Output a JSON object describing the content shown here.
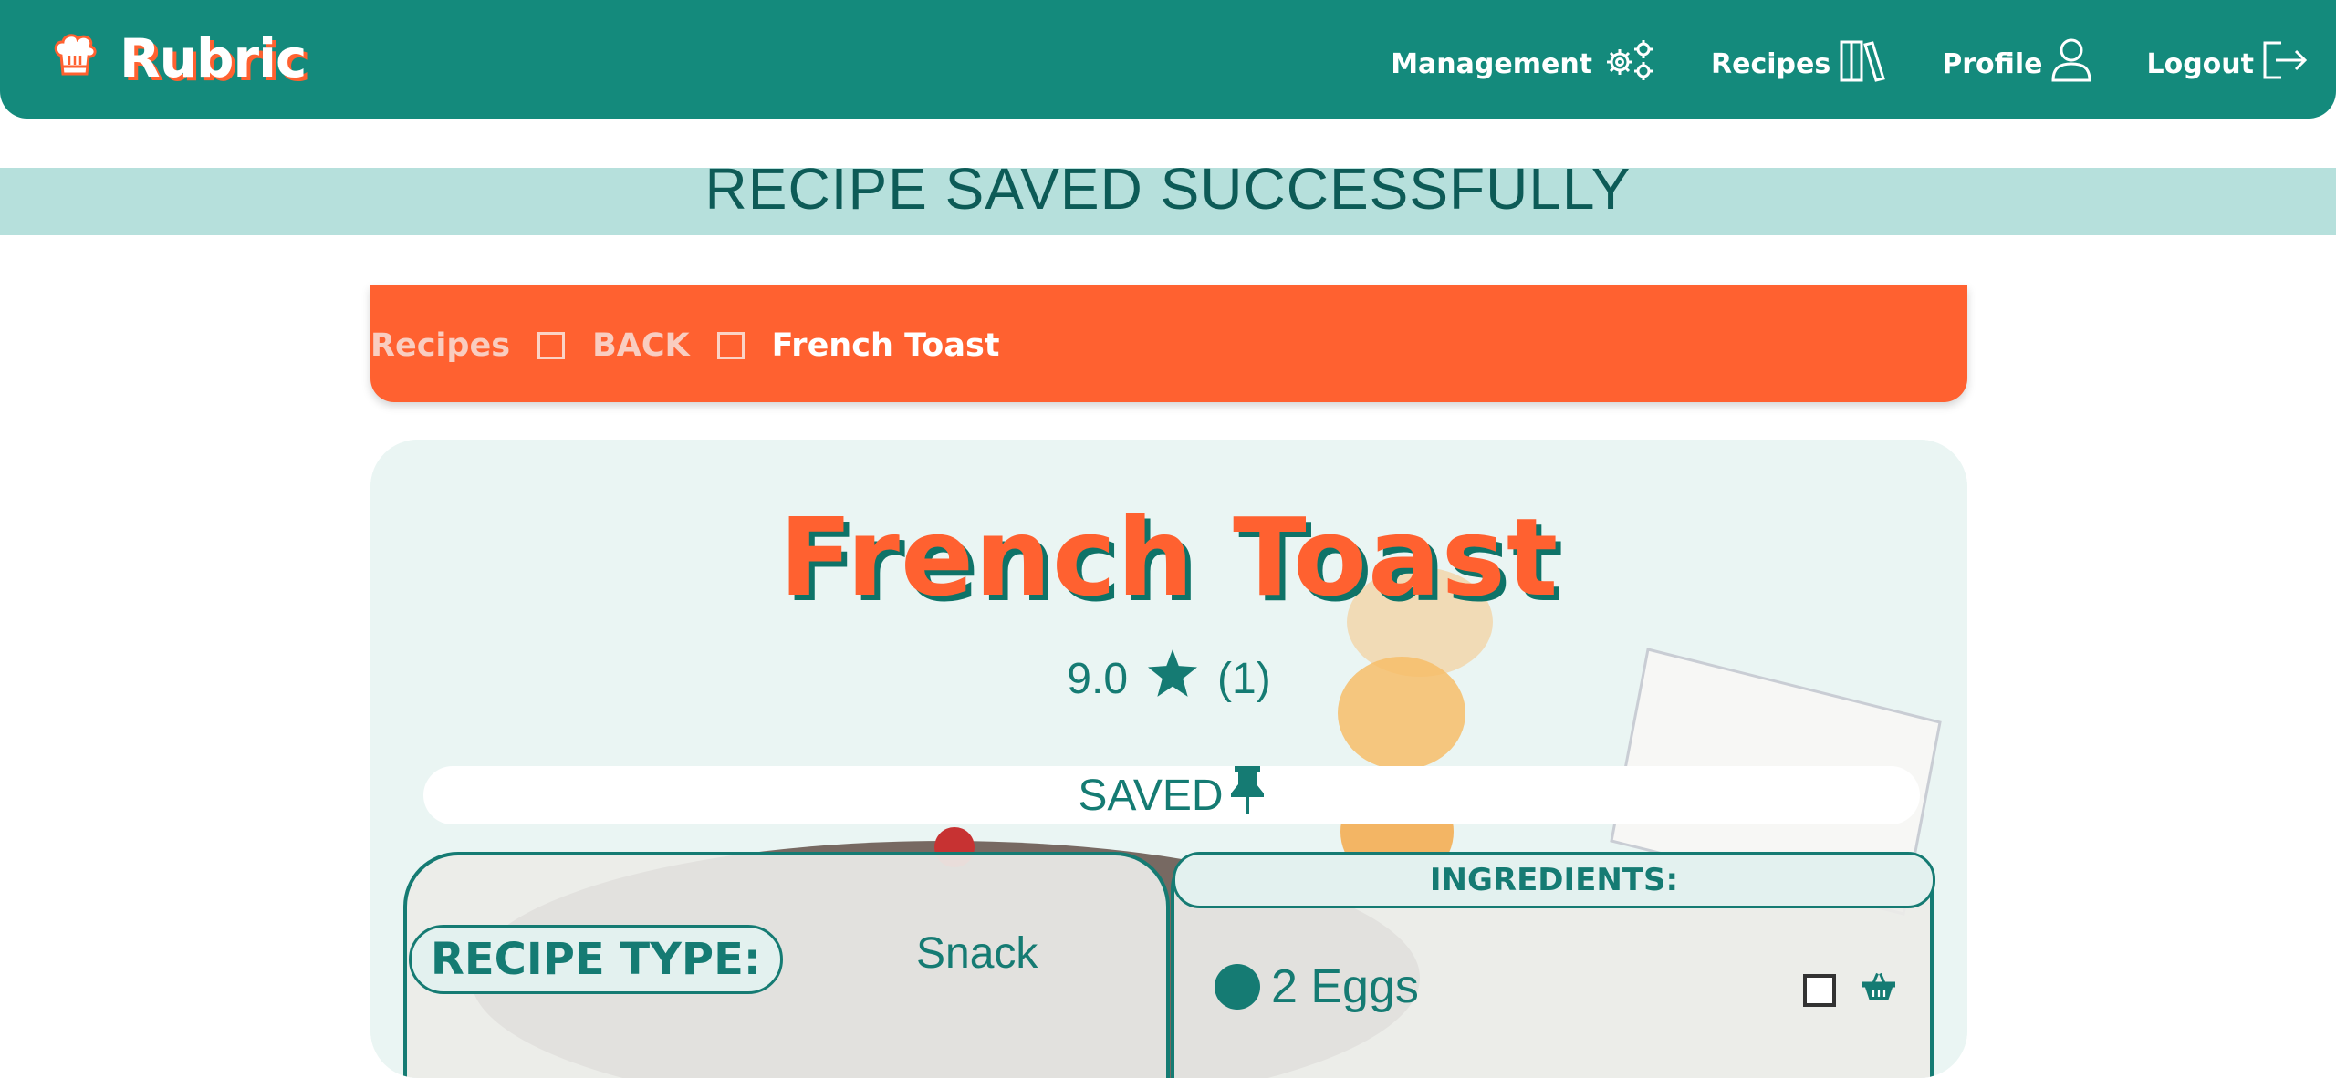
{
  "navbar": {
    "brand": "Rubric",
    "links": [
      {
        "label": "Management",
        "icon": "gears-icon"
      },
      {
        "label": "Recipes",
        "icon": "books-icon"
      },
      {
        "label": "Profile",
        "icon": "user-icon"
      },
      {
        "label": "Logout",
        "icon": "logout-icon"
      }
    ]
  },
  "banner": {
    "message": "RECIPE SAVED SUCCESSFULLY"
  },
  "breadcrumb": {
    "items": [
      "Recipes",
      "BACK",
      "French Toast"
    ]
  },
  "recipe": {
    "title": "French Toast",
    "rating": "9.0",
    "rating_count": "(1)",
    "saved_label": "SAVED",
    "type_label": "RECIPE TYPE:",
    "type_value": "Snack",
    "ingredients_label": "INGREDIENTS:",
    "ingredients": [
      "2 Eggs"
    ]
  },
  "colors": {
    "primary": "#148a7c",
    "accent": "#ff6130",
    "banner_bg": "#b6e0dc",
    "text_teal": "#157b73"
  }
}
